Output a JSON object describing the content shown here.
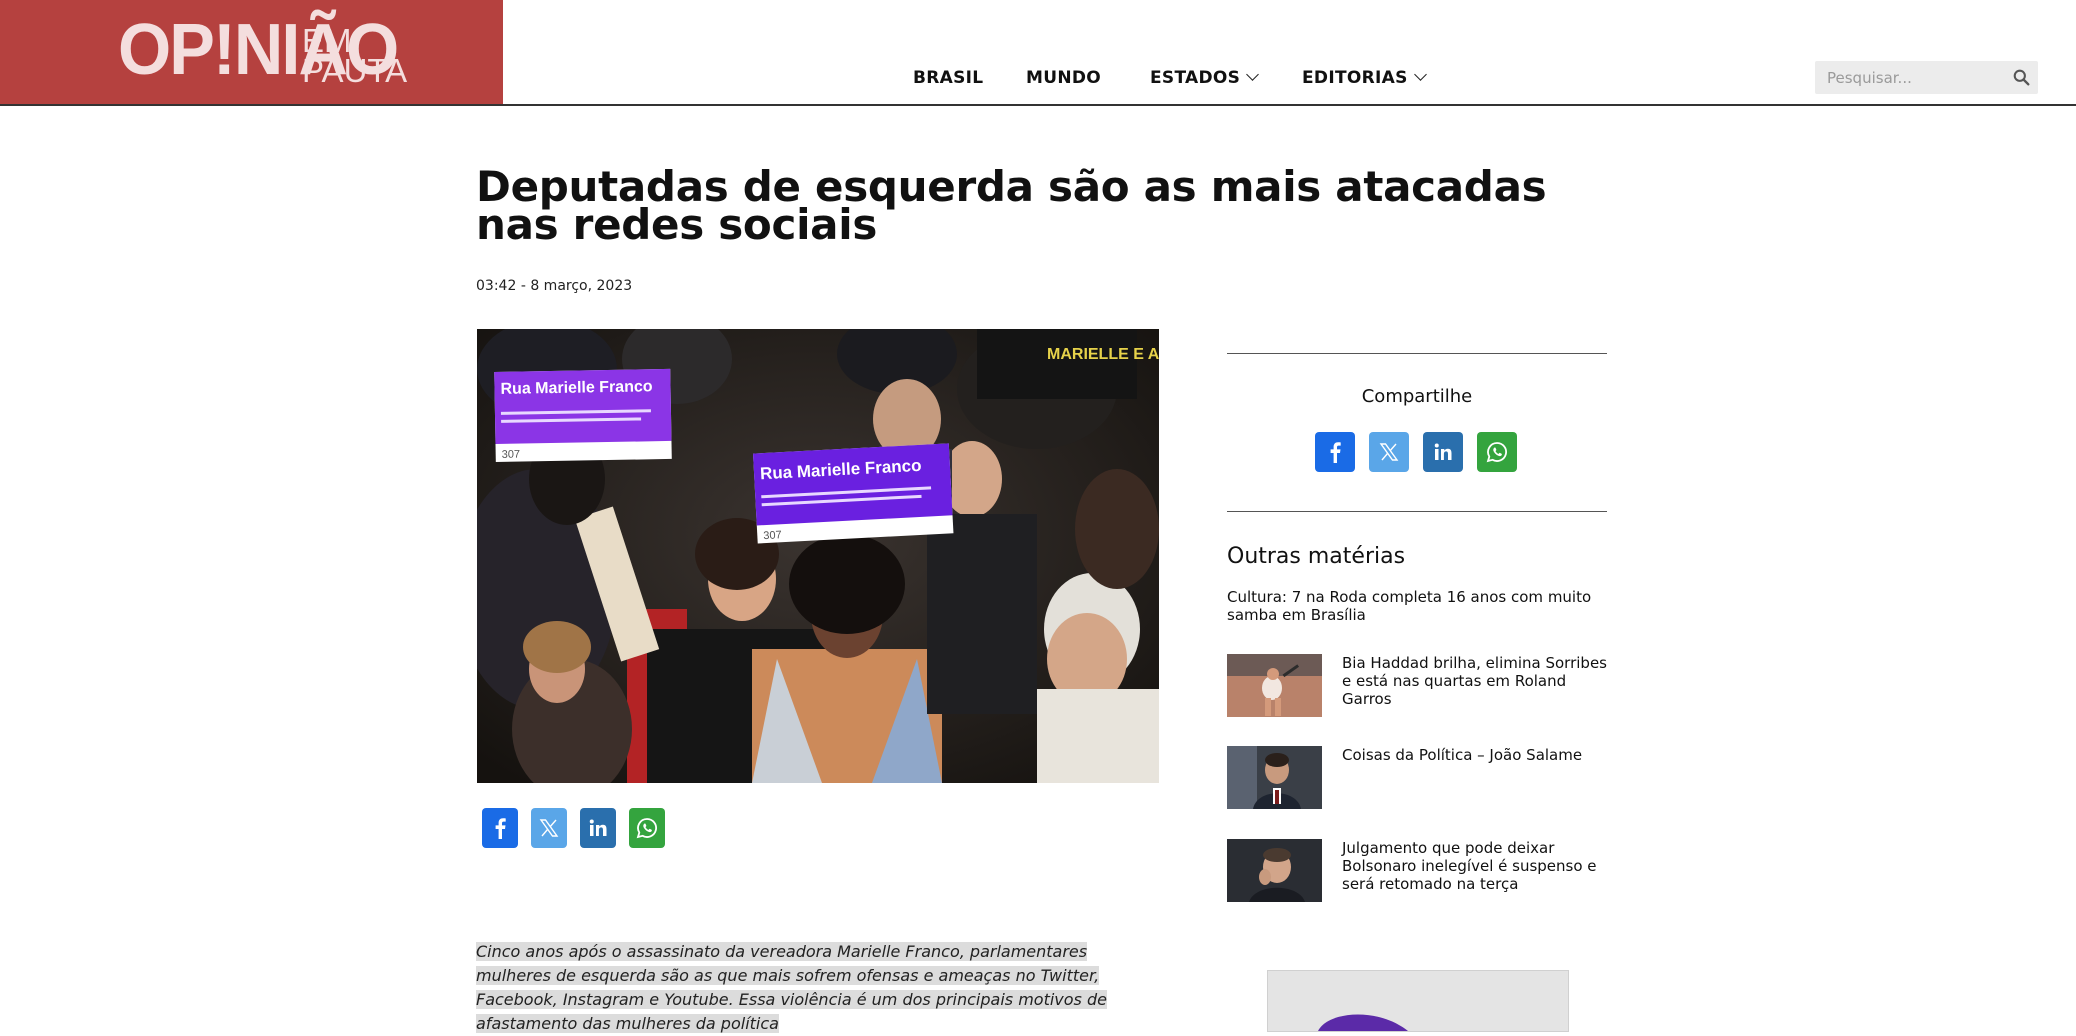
{
  "brand": {
    "name": "OP!NIÃO",
    "sub_line1": "EM",
    "sub_line2": "PAUTA",
    "color": "#b5413f"
  },
  "nav": {
    "items": [
      "BRASIL",
      "MUNDO",
      "ESTADOS",
      "EDITORIAS"
    ]
  },
  "search": {
    "placeholder": "Pesquisar..."
  },
  "article": {
    "title": "Deputadas de esquerda são as mais atacadas nas redes sociais",
    "time": "03:42",
    "date": "8 março, 2023",
    "hero_sign1_title": "Rua Marielle Franco",
    "hero_sign2_title": "Rua Marielle Franco",
    "hero_sign_number": "307",
    "hero_banner": "MARIELLE E ANDERSON",
    "lead": "Cinco anos após o assassinato da vereadora Marielle Franco, parlamentares mulheres de esquerda são as que mais sofrem ofensas e ameaças no Twitter, Facebook, Instagram e Youtube. Essa violência é um dos principais motivos de afastamento das mulheres da política"
  },
  "share": {
    "title": "Compartilhe",
    "networks": [
      "facebook",
      "x-twitter",
      "linkedin",
      "whatsapp"
    ]
  },
  "sidebar": {
    "title": "Outras matérias",
    "plain_item": "Cultura: 7 na Roda completa 16 anos com muito samba em Brasília",
    "items": [
      {
        "text": "Bia Haddad brilha, elimina Sorribes e está nas quartas em Roland Garros"
      },
      {
        "text": "Coisas da Política – João Salame"
      },
      {
        "text": "Julgamento que pode deixar Bolsonaro inelegível é suspenso e será retomado na terça"
      }
    ]
  },
  "colors": {
    "facebook": "#1a6be6",
    "x": "#5aa6e8",
    "linkedin": "#2a6fad",
    "whatsapp": "#34a43e"
  }
}
